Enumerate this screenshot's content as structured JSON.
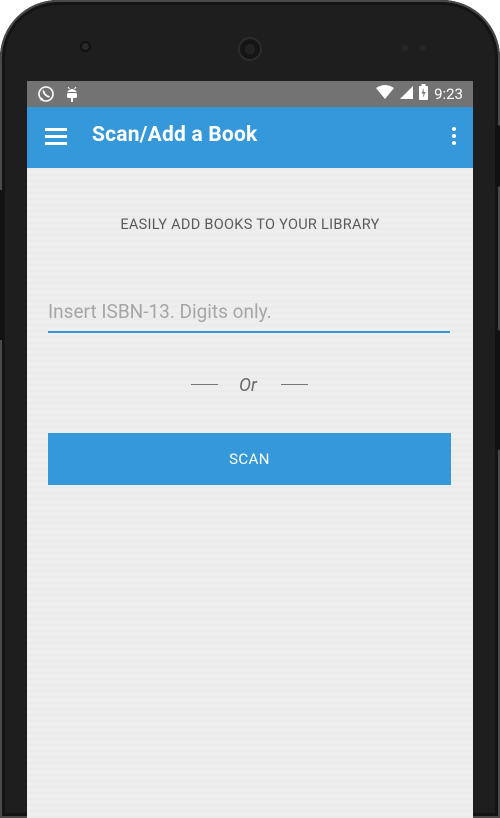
{
  "statusbar": {
    "time": "9:23",
    "icons": [
      "whatsapp-icon",
      "android-debug-icon",
      "wifi-icon",
      "signal-icon",
      "battery-charging-icon"
    ]
  },
  "appbar": {
    "title": "Scan/Add a Book",
    "menu_icon": "hamburger-menu-icon",
    "overflow_icon": "more-vert-icon"
  },
  "main": {
    "headline": "EASILY ADD BOOKS TO YOUR LIBRARY",
    "isbn_input": {
      "value": "",
      "placeholder": "Insert ISBN-13. Digits only."
    },
    "divider_text": "Or",
    "scan_button_label": "SCAN"
  },
  "colors": {
    "primary": "#3498db",
    "statusbar": "#737373",
    "background": "#eeeeee"
  }
}
